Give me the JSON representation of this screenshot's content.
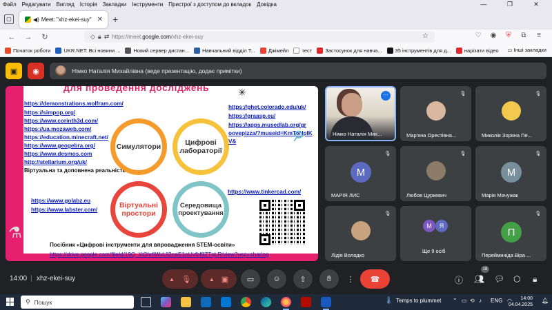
{
  "menubar": {
    "items": [
      "Файл",
      "Редагувати",
      "Вигляд",
      "Історія",
      "Закладки",
      "Інструменти",
      "Пристрої з доступом до вкладок",
      "Довідка"
    ]
  },
  "tab": {
    "title": "Meet: \"xhz-ekei-suy\""
  },
  "urlbar": {
    "host": "https://meet.",
    "domain": "google.com",
    "path": "/xhz-ekei-suy"
  },
  "bookmarks": [
    {
      "label": "Початок роботи",
      "color": "#e34c26"
    },
    {
      "label": "UKR.NET: Всі новини ...",
      "color": "#1f5fbf"
    },
    {
      "label": "Новий сервер дистан...",
      "color": "#555555"
    },
    {
      "label": "Навчальний відділ Т...",
      "color": "#2d5fa8"
    },
    {
      "label": "Джімейл",
      "color": "#ea4335"
    },
    {
      "label": "тест",
      "color": "#ffffff"
    },
    {
      "label": "Застосунок для навча...",
      "color": "#e4272d"
    },
    {
      "label": "35 інструментів для д...",
      "color": "#111111"
    },
    {
      "label": "нарізати відео",
      "color": "#e4272d"
    }
  ],
  "bookmarks_other": "Інші закладки",
  "meet": {
    "presenter_label": "Німко Наталія Михайлівна (веде презентацію, додає примітки)",
    "time": "14:00",
    "separator": "|",
    "meeting_code": "xhz-ekei-suy",
    "people_count": "18"
  },
  "slide": {
    "header": "для проведення досліджень",
    "links_left": [
      "https://demonstrations.wolfram.com/",
      "https://simpop.org/",
      "https://www.corinth3d.com/",
      "https://ua.mozaweb.com/",
      "https://education.minecraft.net/",
      "https://www.geogebra.org/",
      "https://www.desmos.com",
      "http://stellarium.org/uk/"
    ],
    "vr_label": "Віртуальна та доповнена реальність",
    "links_right": [
      "https://phet.colorado.edu/uk/",
      "https://graasp.eu/",
      "https://apps.musedlab.org/gr",
      "oovepizza/?museid=KmT6NpIK",
      "V&"
    ],
    "links_bottom_left": [
      "https://www.golabz.eu",
      "https://www.labster.com/"
    ],
    "tinkercad": "https://www.tinkercad.com/",
    "circle_1": "Симулятори",
    "circle_2a": "Цифрові",
    "circle_2b": "лабораторії",
    "circle_3a": "Віртуальні",
    "circle_3b": "простори",
    "circle_4a": "Середовища",
    "circle_4b": "проектування",
    "guide": "Посібник «Цифрові інструменти для впровадження STEM-освіти»",
    "drive_link": "https://drive.google.com/file/d/19Q_Xt3hrfiWxUl2cai51oUvfbf8ZTqLR/view?usp=sharing"
  },
  "participants": [
    {
      "name": "Німко Наталія Мих...",
      "type": "video"
    },
    {
      "name": "Мар'яна Орестівна...",
      "type": "photo",
      "color": "#d9b89f"
    },
    {
      "name": "Миколів Зоряна Пе...",
      "type": "photo",
      "color": "#f2c94c"
    },
    {
      "name": "МАРІЯ ЛИС",
      "type": "letter",
      "letter": "М",
      "color": "#5c6bc0"
    },
    {
      "name": "Любов Цуркевич",
      "type": "photo",
      "color": "#8d7b6a"
    },
    {
      "name": "Марія Мачужак",
      "type": "letter",
      "letter": "М",
      "color": "#78909c"
    },
    {
      "name": "Лідія Володко",
      "type": "photo",
      "color": "#c9a27e"
    },
    {
      "name": "Ще 9 осіб",
      "type": "group",
      "letters": [
        "М",
        "Я"
      ],
      "colors": [
        "#7e57c2",
        "#5c6bc0"
      ]
    },
    {
      "name": "Перейминіда Віра ...",
      "type": "letter",
      "letter": "П",
      "color": "#43a047"
    }
  ],
  "taskbar": {
    "search_placeholder": "Пошук",
    "weather": "Temps to plummet",
    "lang": "ENG",
    "clock_time": "14:00",
    "clock_date": "04.04.2025"
  }
}
